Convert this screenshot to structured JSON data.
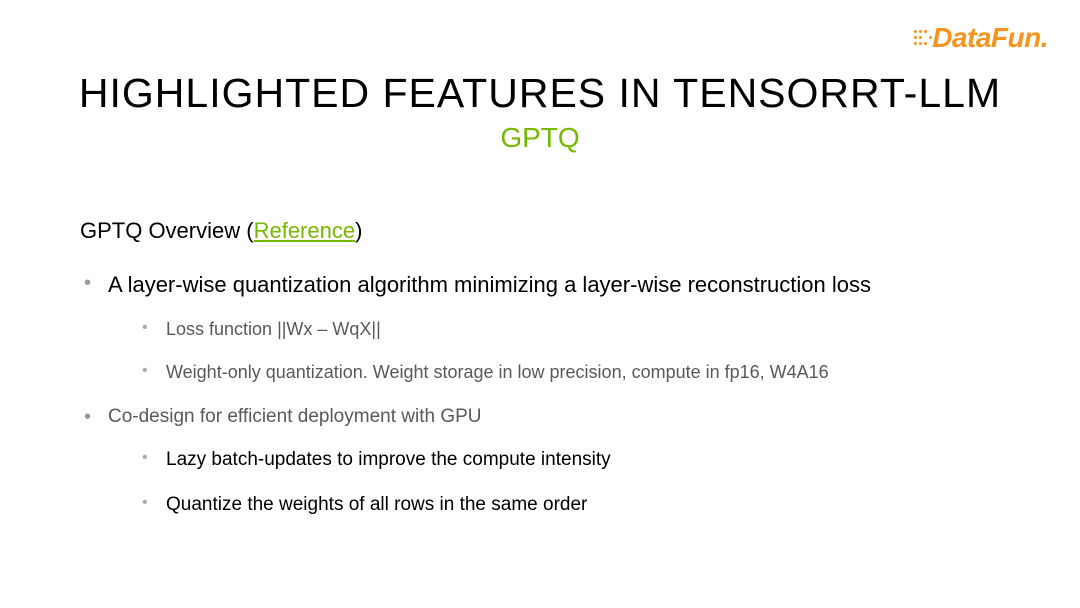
{
  "logo": {
    "text": "DataFun."
  },
  "title": "HIGHLIGHTED FEATURES IN TENSORRT-LLM",
  "subtitle": "GPTQ",
  "overview": {
    "prefix": "GPTQ Overview (",
    "link": "Reference",
    "suffix": ")"
  },
  "bullets": {
    "b1": "A layer-wise quantization algorithm minimizing a layer-wise reconstruction loss",
    "b1_1": "Loss function ||Wx – WqX||",
    "b1_2": "Weight-only quantization. Weight storage in low precision, compute in fp16, W4A16",
    "b2": "Co-design for efficient deployment with GPU",
    "b2_1": "Lazy batch-updates to improve the compute intensity",
    "b2_2": "Quantize the weights of all rows in the same order"
  }
}
